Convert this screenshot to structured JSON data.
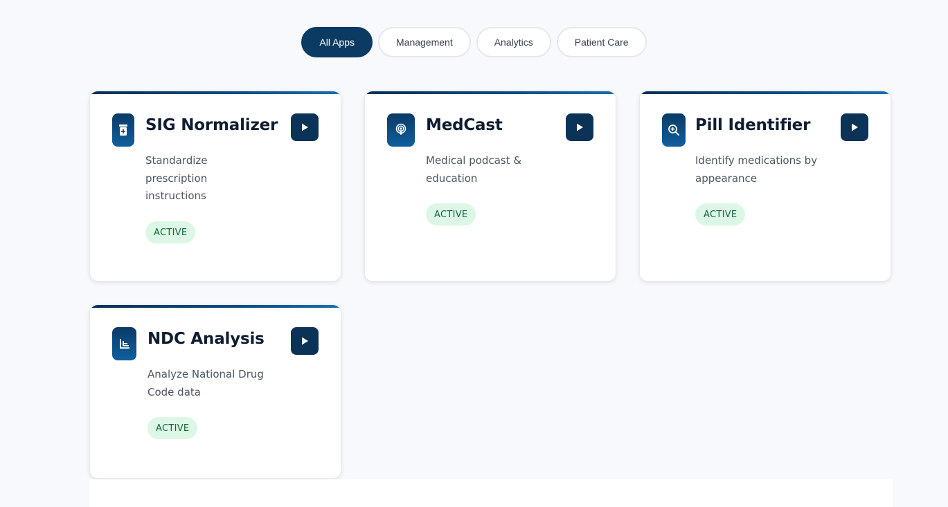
{
  "tabs": [
    {
      "label": "All Apps",
      "active": true
    },
    {
      "label": "Management",
      "active": false
    },
    {
      "label": "Analytics",
      "active": false
    },
    {
      "label": "Patient Care",
      "active": false
    }
  ],
  "cards": [
    {
      "title": "SIG Normalizer",
      "description": "Standardize prescription instructions",
      "status": "ACTIVE",
      "icon": "prescription-bottle-icon"
    },
    {
      "title": "MedCast",
      "description": "Medical podcast & education",
      "status": "ACTIVE",
      "icon": "podcast-icon"
    },
    {
      "title": "Pill Identifier",
      "description": "Identify medications by appearance",
      "status": "ACTIVE",
      "icon": "magnify-icon"
    },
    {
      "title": "NDC Analysis",
      "description": "Analyze National Drug Code data",
      "status": "ACTIVE",
      "icon": "chart-icon"
    }
  ],
  "colors": {
    "primary": "#0b3a63",
    "badge_bg": "#dcf7e6",
    "badge_text": "#15673a",
    "background": "#f7f9fc"
  }
}
